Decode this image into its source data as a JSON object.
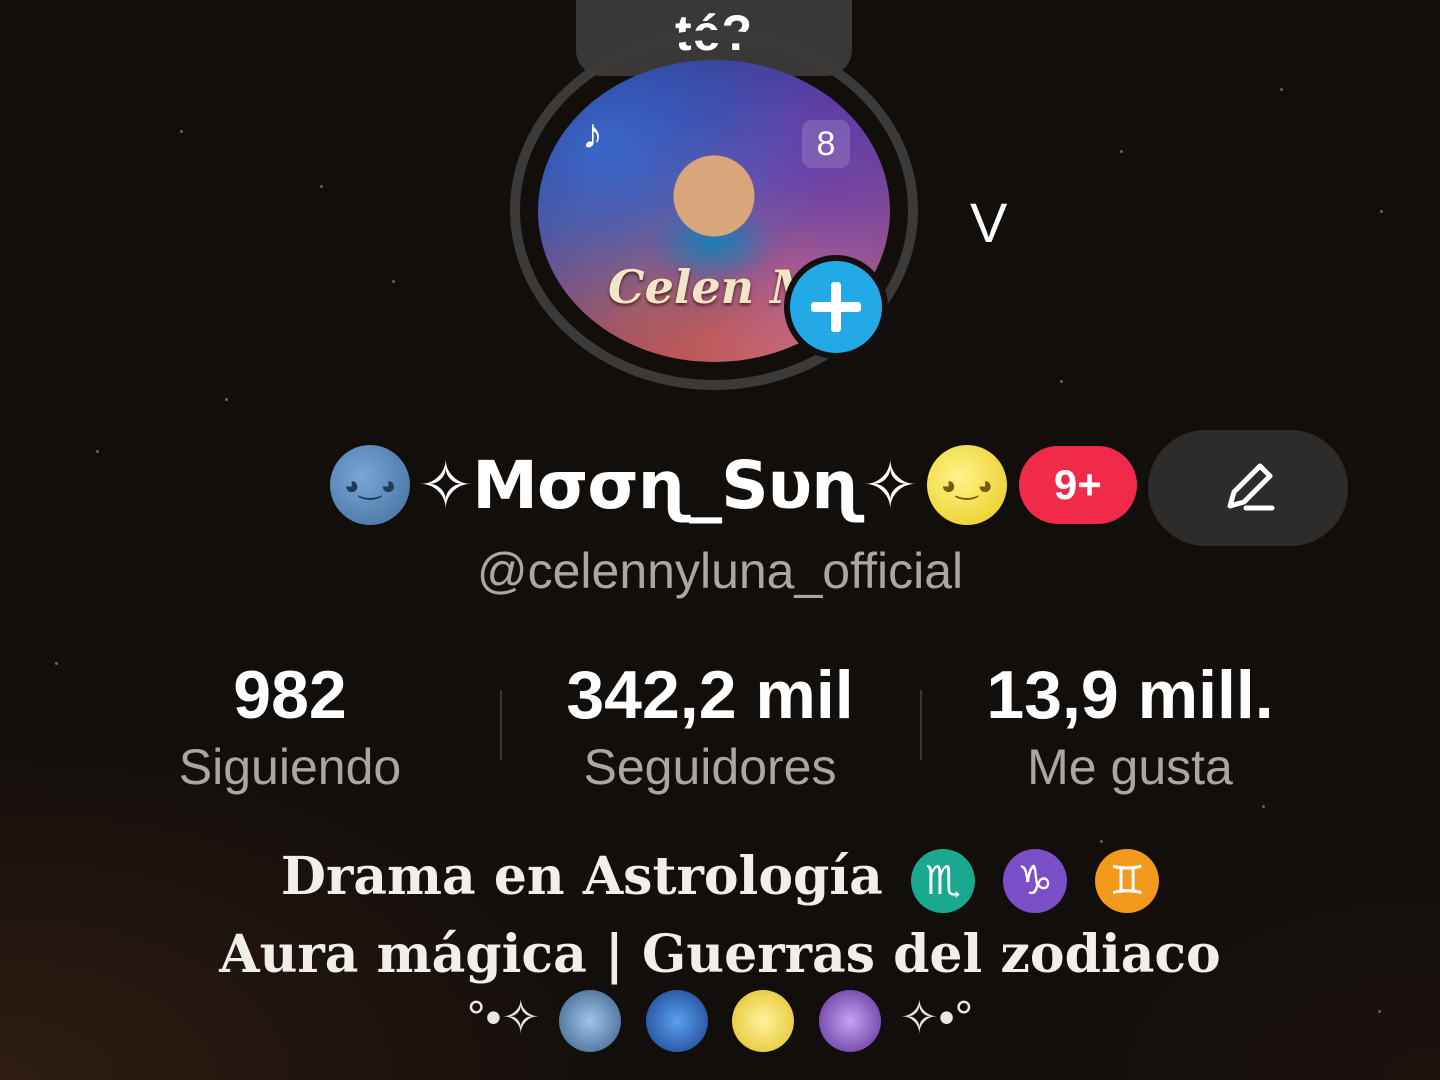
{
  "tooltip": {
    "text": "té?"
  },
  "avatar": {
    "tiktok_label": "♪",
    "capcut_label": "8",
    "signature": "Celen M"
  },
  "header": {
    "chevron": "V"
  },
  "profile": {
    "name": "✧Mσσɳ_Sυɳ✧",
    "notification_badge": "9+",
    "handle": "@celennyluna_official"
  },
  "stats": [
    {
      "value": "982",
      "label": "Siguiendo"
    },
    {
      "value": "342,2 mil",
      "label": "Seguidores"
    },
    {
      "value": "13,9 mill.",
      "label": "Me gusta"
    }
  ],
  "bio": {
    "line1": "Drama en Astrología",
    "zodiac_signs": [
      "♏",
      "♑",
      "♊"
    ],
    "zodiac_colors": [
      "#1aa88f",
      "#7a4fc8",
      "#f29a1c"
    ],
    "line2": "Aura mágica | Guerras del zodiaco",
    "deco_left": "°•✧",
    "deco_right": "✧•°"
  },
  "colors": {
    "follow_button": "#22a9e6",
    "badge": "#f02a48",
    "background": "#120e0c"
  }
}
